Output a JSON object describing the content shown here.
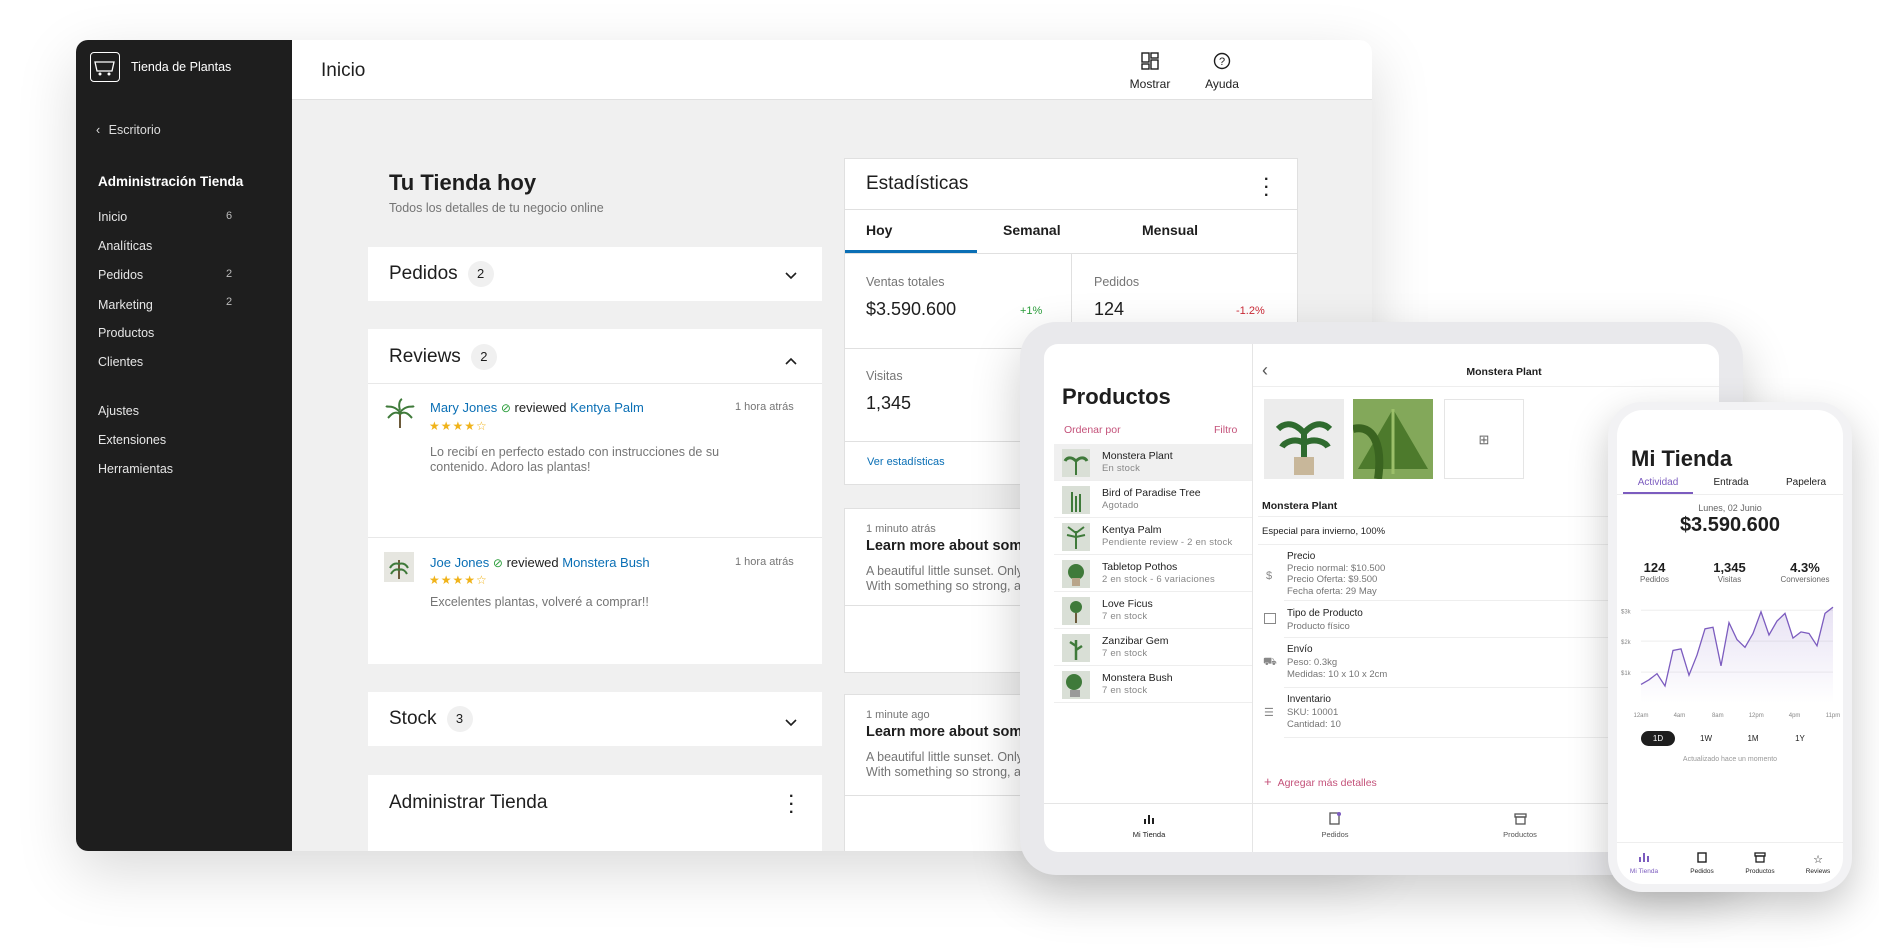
{
  "desktop": {
    "sidebar": {
      "store_name": "Tienda de Plantas",
      "back_label": "Escritorio",
      "section_title": "Administración Tienda",
      "items": [
        {
          "label": "Inicio",
          "count": "6"
        },
        {
          "label": "Analíticas",
          "count": ""
        },
        {
          "label": "Pedidos",
          "count": "2"
        },
        {
          "label": "Marketing",
          "count": "2"
        },
        {
          "label": "Productos",
          "count": ""
        },
        {
          "label": "Clientes",
          "count": ""
        }
      ],
      "items2": [
        {
          "label": "Ajustes"
        },
        {
          "label": "Extensiones"
        },
        {
          "label": "Herramientas"
        }
      ]
    },
    "header": {
      "title": "Inicio",
      "display_label": "Mostrar",
      "help_label": "Ayuda"
    },
    "main": {
      "title": "Tu Tienda hoy",
      "subtitle": "Todos los detalles de tu negocio online",
      "orders": {
        "title": "Pedidos",
        "count": "2"
      },
      "reviews": {
        "title": "Reviews",
        "count": "2",
        "items": [
          {
            "author": "Mary Jones",
            "verb": "reviewed",
            "product": "Kentya Palm",
            "time": "1 hora atrás",
            "rating": 4,
            "text": "Lo recibí en perfecto estado con instrucciones de su contenido. Adoro las plantas!"
          },
          {
            "author": "Joe Jones",
            "verb": "reviewed",
            "product": "Monstera Bush",
            "time": "1 hora atrás",
            "rating": 4,
            "text": "Excelentes plantas, volveré a comprar!!"
          }
        ]
      },
      "stock": {
        "title": "Stock",
        "count": "3"
      },
      "manage": {
        "title": "Administrar Tienda"
      }
    },
    "stats": {
      "title": "Estadísticas",
      "tabs": [
        "Hoy",
        "Semanal",
        "Mensual"
      ],
      "total_sales": {
        "label": "Ventas totales",
        "value": "$3.590.600",
        "delta": "+1%"
      },
      "orders": {
        "label": "Pedidos",
        "value": "124",
        "delta": "-1.2%"
      },
      "visits": {
        "label": "Visitas",
        "value": "1,345"
      },
      "link": "Ver estadísticas"
    },
    "news": [
      {
        "time": "1 minuto atrás",
        "title": "Learn more about som",
        "text1": "A beautiful little sunset. Only",
        "text2": "With something so strong, a"
      },
      {
        "time": "1 minute ago",
        "title": "Learn more about som",
        "text1": "A beautiful little sunset. Only",
        "text2": "With something so strong, a"
      }
    ]
  },
  "tablet": {
    "title": "Productos",
    "sort_label": "Ordenar por",
    "filter_label": "Filtro",
    "products": [
      {
        "name": "Monstera Plant",
        "status": "En stock"
      },
      {
        "name": "Bird of Paradise Tree",
        "status": "Agotado"
      },
      {
        "name": "Kentya Palm",
        "status": "Pendiente review - 2 en stock"
      },
      {
        "name": "Tabletop Pothos",
        "status": "2 en stock - 6 variaciones"
      },
      {
        "name": "Love Ficus",
        "status": "7 en stock"
      },
      {
        "name": "Zanzibar Gem",
        "status": "7 en stock"
      },
      {
        "name": "Monstera Bush",
        "status": "7 en stock"
      }
    ],
    "detail": {
      "header": "Monstera Plant",
      "name": "Monstera Plant",
      "description": "Especial para invierno, 100%",
      "price": {
        "label": "Precio",
        "lines": [
          "Precio normal: $10.500",
          "Precio Oferta: $9.500",
          "Fecha oferta: 29 May"
        ]
      },
      "type": {
        "label": "Tipo de Producto",
        "lines": [
          "Producto físico"
        ]
      },
      "shipping": {
        "label": "Envío",
        "lines": [
          "Peso: 0.3kg",
          "Medidas: 10 x 10 x 2cm"
        ]
      },
      "inventory": {
        "label": "Inventario",
        "lines": [
          "SKU: 10001",
          "Cantidad: 10"
        ]
      },
      "add_more": "Agregar más detalles"
    },
    "nav": [
      "Mi Tienda",
      "Pedidos",
      "Productos"
    ]
  },
  "phone": {
    "title": "Mi Tienda",
    "tabs": [
      "Actividad",
      "Entrada",
      "Papelera"
    ],
    "date": "Lunes, 02 Junio",
    "total": "$3.590.600",
    "kpis": [
      {
        "value": "124",
        "label": "Pedidos"
      },
      {
        "value": "1,345",
        "label": "Visitas"
      },
      {
        "value": "4.3%",
        "label": "Conversiones"
      }
    ],
    "ranges": [
      "1D",
      "1W",
      "1M",
      "1Y"
    ],
    "updated": "Actualizado hace un momento",
    "nav": [
      "Mi Tienda",
      "Pedidos",
      "Productos",
      "Reviews"
    ],
    "chart_data": {
      "type": "area",
      "y_ticks": [
        "$3k",
        "$2k",
        "$1k"
      ],
      "x_ticks": [
        "12am",
        "4am",
        "8am",
        "12pm",
        "4pm",
        "11pm"
      ],
      "values": [
        0.6,
        0.75,
        0.95,
        0.55,
        1.7,
        1.75,
        0.9,
        1.55,
        2.4,
        2.45,
        1.2,
        2.6,
        2.05,
        1.8,
        2.25,
        2.95,
        2.2,
        2.65,
        2.9,
        2.1,
        2.3,
        2.25,
        1.85,
        2.9,
        3.1
      ],
      "ylim": [
        0,
        3.3
      ]
    },
    "colors": {
      "accent": "#7c5cbf",
      "sidebar": "#1e1e1e",
      "link": "#0a6fb5",
      "positive": "#2a9d3a",
      "negative": "#cc2936"
    }
  }
}
